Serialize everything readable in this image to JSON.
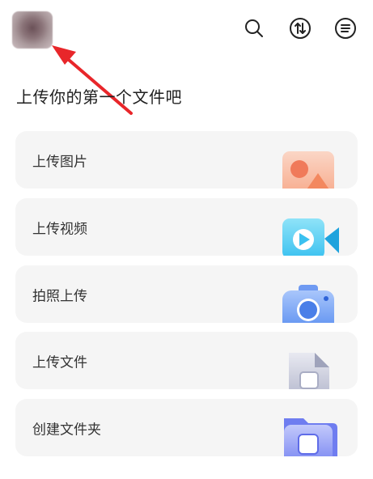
{
  "header": {
    "avatar": "user-avatar-blurred",
    "icons": [
      "search-icon",
      "transfer-icon",
      "menu-icon"
    ]
  },
  "title": "上传你的第一个文件吧",
  "cards": [
    {
      "label": "上传图片",
      "icon": "image-icon"
    },
    {
      "label": "上传视频",
      "icon": "video-icon"
    },
    {
      "label": "拍照上传",
      "icon": "camera-icon"
    },
    {
      "label": "上传文件",
      "icon": "file-icon"
    },
    {
      "label": "创建文件夹",
      "icon": "folder-icon"
    }
  ],
  "colors": {
    "annotation_arrow": "#e8262a",
    "card_background": "#f5f5f5",
    "image_icon": "#f59a7a",
    "video_icon": "#3ac1f0",
    "camera_icon": "#5b8ff0",
    "file_icon": "#b9bcd0",
    "folder_icon": "#6f7df0"
  }
}
